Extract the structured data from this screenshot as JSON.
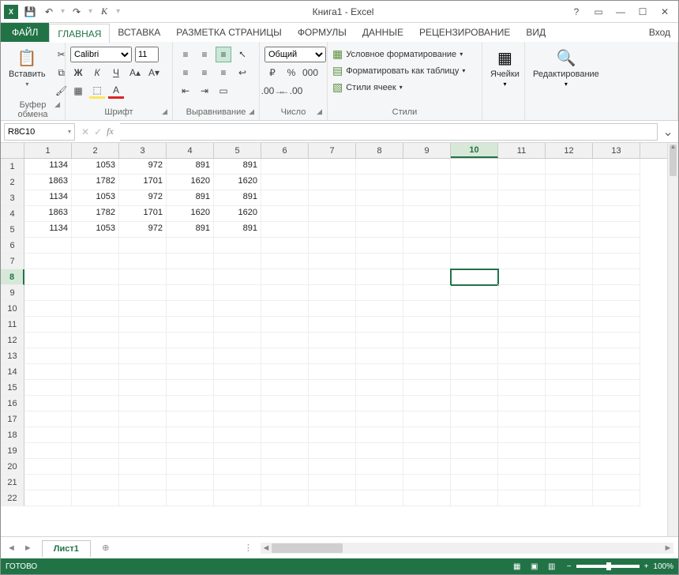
{
  "title": "Книга1 - Excel",
  "qat": {
    "italic_label": "К"
  },
  "tabs": {
    "file": "ФАЙЛ",
    "items": [
      "ГЛАВНАЯ",
      "ВСТАВКА",
      "РАЗМЕТКА СТРАНИЦЫ",
      "ФОРМУЛЫ",
      "ДАННЫЕ",
      "РЕЦЕНЗИРОВАНИЕ",
      "ВИД"
    ],
    "active_index": 0,
    "login": "Вход"
  },
  "ribbon": {
    "clipboard": {
      "paste": "Вставить",
      "label": "Буфер обмена"
    },
    "font": {
      "label": "Шрифт",
      "name": "Calibri",
      "size": "11",
      "bold": "Ж",
      "italic": "К",
      "underline": "Ч"
    },
    "alignment": {
      "label": "Выравнивание"
    },
    "number": {
      "label": "Число",
      "format": "Общий",
      "percent": "%",
      "thousands": "000"
    },
    "styles": {
      "label": "Стили",
      "cond": "Условное форматирование",
      "table": "Форматировать как таблицу",
      "cell": "Стили ячеек"
    },
    "cells": {
      "label": "Ячейки"
    },
    "editing": {
      "label": "Редактирование"
    }
  },
  "namebox": "R8C10",
  "grid": {
    "col_count": 13,
    "row_count": 22,
    "active_row": 8,
    "active_col": 10,
    "data": [
      [
        1134,
        1053,
        972,
        891,
        891
      ],
      [
        1863,
        1782,
        1701,
        1620,
        1620
      ],
      [
        1134,
        1053,
        972,
        891,
        891
      ],
      [
        1863,
        1782,
        1701,
        1620,
        1620
      ],
      [
        1134,
        1053,
        972,
        891,
        891
      ]
    ]
  },
  "sheet": {
    "name": "Лист1"
  },
  "status": {
    "ready": "ГОТОВО",
    "zoom": "100%"
  }
}
